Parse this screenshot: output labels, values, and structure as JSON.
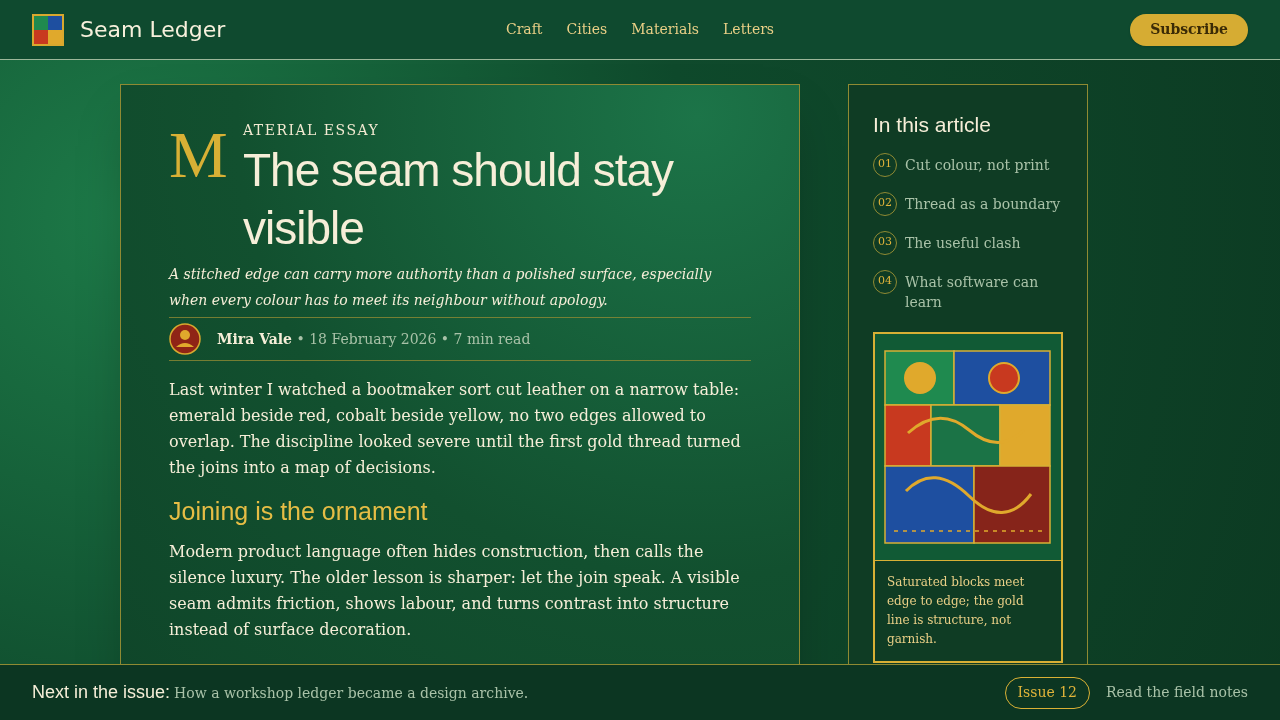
{
  "header": {
    "brand": "Seam Ledger",
    "nav": [
      {
        "label": "Craft"
      },
      {
        "label": "Cities"
      },
      {
        "label": "Materials"
      },
      {
        "label": "Letters"
      }
    ],
    "subscribe": "Subscribe"
  },
  "article": {
    "drop_cap": "M",
    "kicker": "ATERIAL ESSAY",
    "title": "The seam should stay visible",
    "dek": "A stitched edge can carry more authority than a polished surface, especially when every colour has to meet its neighbour without apology.",
    "author": "Mira Vale",
    "meta": "• 18 February 2026 • 7 min read",
    "blocks": [
      {
        "kind": "paragraph",
        "text": "Last winter I watched a bootmaker sort cut leather on a narrow table: emerald beside red, cobalt beside yellow, no two edges allowed to overlap. The discipline looked severe until the first gold thread turned the joins into a map of decisions."
      },
      {
        "kind": "heading",
        "text": "Joining is the ornament"
      },
      {
        "kind": "paragraph",
        "text": "Modern product language often hides construction, then calls the silence luxury. The older lesson is sharper: let the join speak. A visible seam admits friction, shows labour, and turns contrast into structure instead of surface decoration."
      }
    ]
  },
  "sidebar": {
    "title": "In this article",
    "toc": [
      {
        "number": "01",
        "label": "Cut colour, not print"
      },
      {
        "number": "02",
        "label": "Thread as a boundary"
      },
      {
        "number": "03",
        "label": "The useful clash"
      },
      {
        "number": "04",
        "label": "What software can learn"
      }
    ],
    "caption": "Saturated blocks meet edge to edge; the gold line is structure, not garnish."
  },
  "footer": {
    "lead": "Next in the issue:",
    "text": "How a workshop ledger became a design archive.",
    "issue": "Issue 12",
    "link": "Read the field notes"
  }
}
